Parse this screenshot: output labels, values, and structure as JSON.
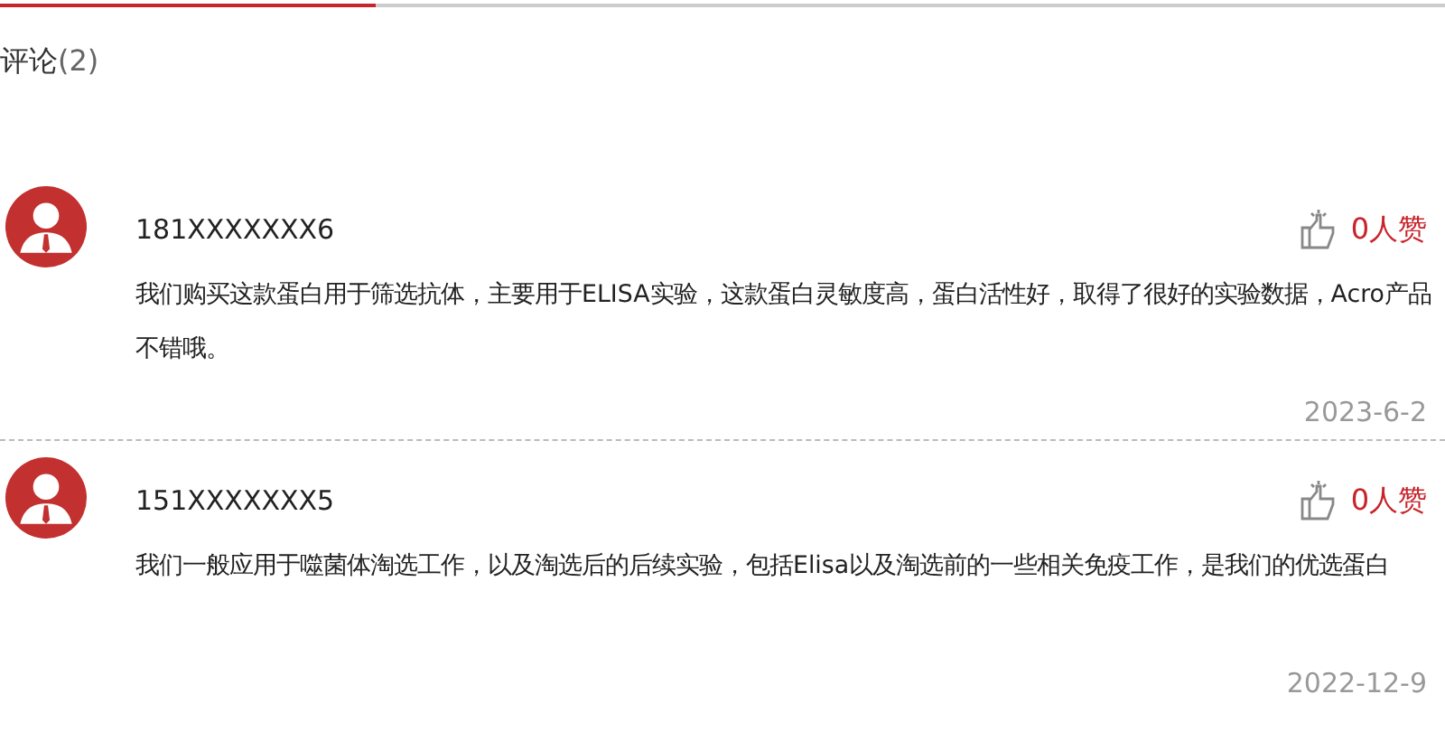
{
  "heading": {
    "label": "评论",
    "count": "(2)"
  },
  "comments": [
    {
      "user": "181XXXXXXX6",
      "likes": "0人赞",
      "text": "我们购买这款蛋白用于筛选抗体，主要用于ELISA实验，这款蛋白灵敏度高，蛋白活性好，取得了很好的实验数据，Acro产品不错哦。",
      "date": "2023-6-2"
    },
    {
      "user": "151XXXXXXX5",
      "likes": "0人赞",
      "text": "我们一般应用于噬菌体淘选工作，以及淘选后的后续实验，包括Elisa以及淘选前的一些相关免疫工作，是我们的优选蛋白",
      "date": "2022-12-9"
    }
  ]
}
